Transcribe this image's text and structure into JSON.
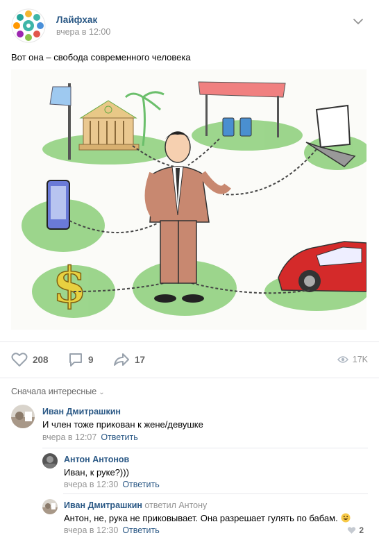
{
  "post": {
    "group_name": "Лайфхак",
    "date": "вчера в 12:00",
    "text": "Вот она – свобода современного человека"
  },
  "actions": {
    "likes": "208",
    "comments": "9",
    "shares": "17",
    "views": "17K"
  },
  "comments_sort": "Сначала интересные",
  "comments": [
    {
      "author": "Иван Дмитрашкин",
      "text": "И член тоже прикован к жене/девушке",
      "date": "вчера в 12:07",
      "reply_label": "Ответить"
    },
    {
      "author": "Антон Антонов",
      "text": "Иван, к руке?)))",
      "date": "вчера в 12:30",
      "reply_label": "Ответить"
    },
    {
      "author": "Иван Дмитрашкин",
      "reply_to": "ответил Антону",
      "text": "Антон, не, рука не приковывает. Она разрешает гулять по бабам.",
      "date": "вчера в 12:30",
      "reply_label": "Ответить",
      "likes": "2"
    }
  ],
  "colors": {
    "link": "#2a5885",
    "muted": "#939393",
    "chain_green": "#8ccf7a"
  }
}
